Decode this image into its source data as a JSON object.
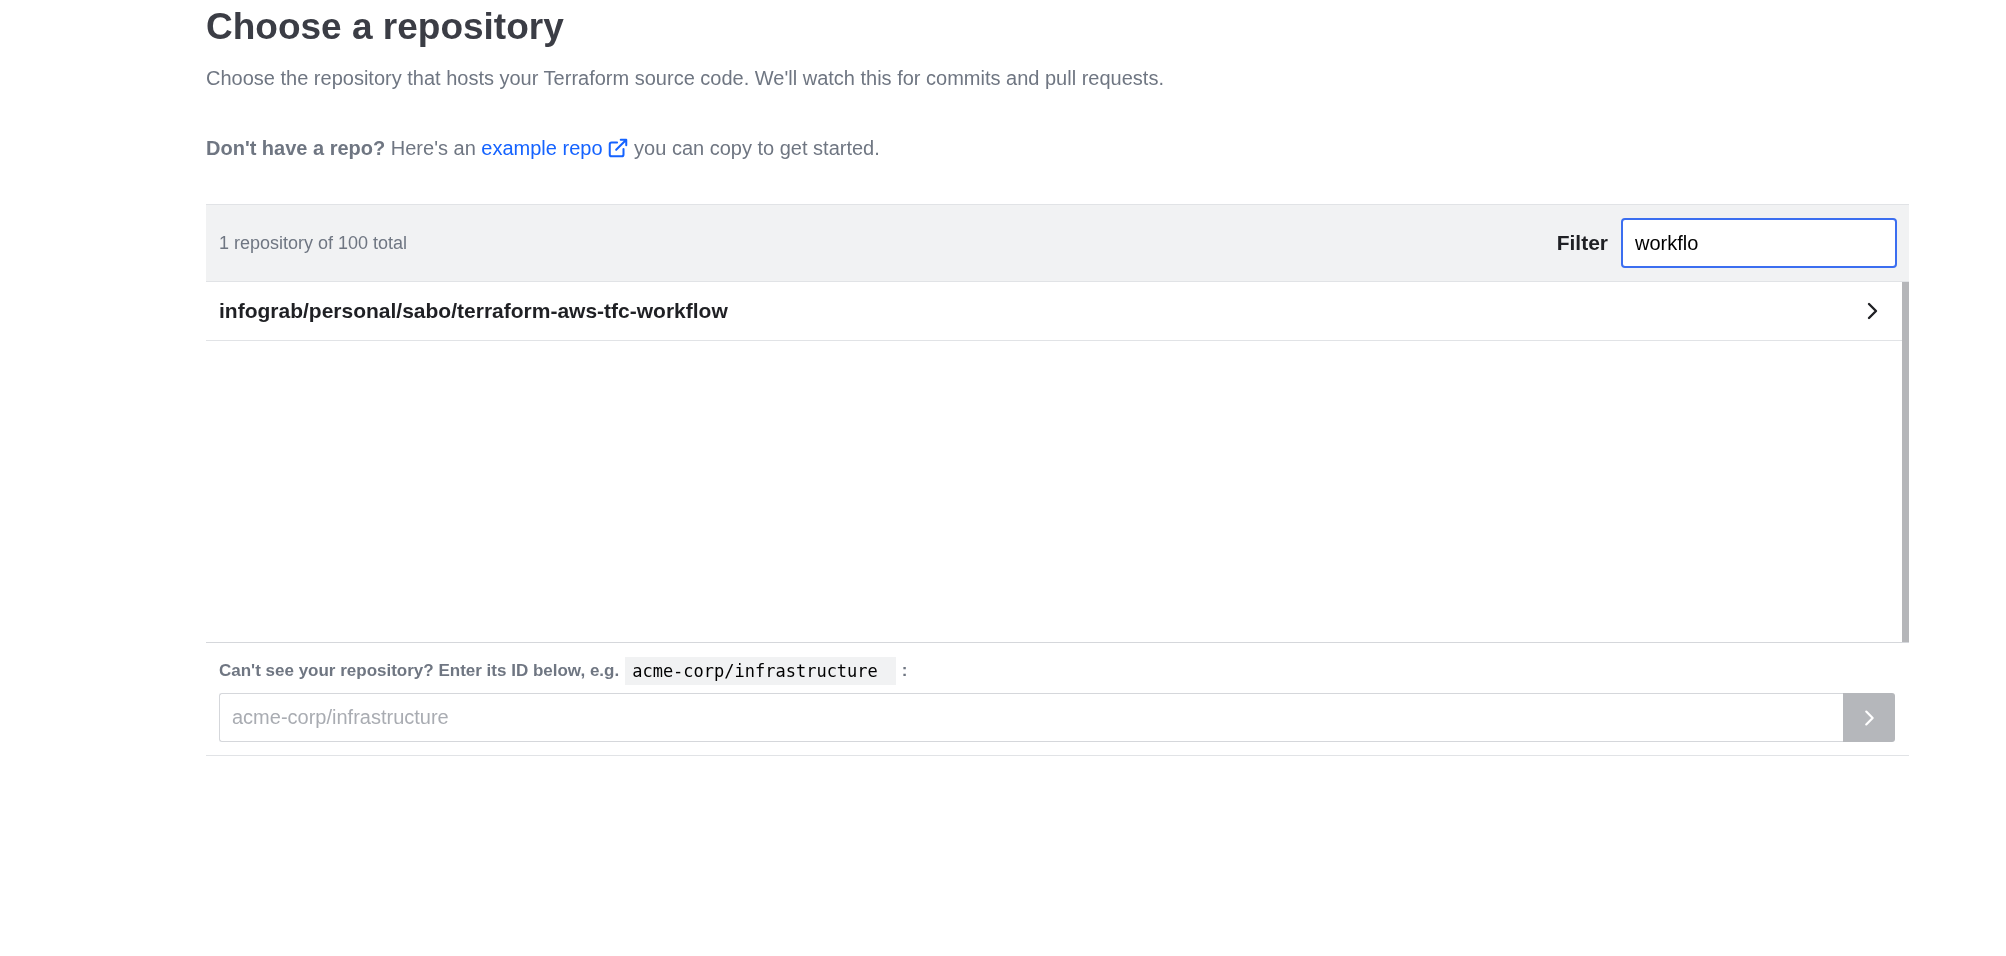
{
  "title": "Choose a repository",
  "description": "Choose the repository that hosts your Terraform source code. We'll watch this for commits and pull requests.",
  "intro": {
    "before": "**Don't have a repo?** Here's an",
    "link": "example repo",
    "after": "you can copy to get started."
  },
  "list_header": {
    "count": "1 repository of 100 total",
    "filter_label": "Filter",
    "filter_value": "workflo",
    "filter_focused": true
  },
  "repositories": [
    {
      "name": "infograb/personal/sabo/terraform-aws-tfc-workflow"
    }
  ],
  "manual_entry": {
    "hint": "Can't see your repository? Enter its ID below, e.g.",
    "example": "acme-corp/infrastructure",
    "hint_end": ":",
    "placeholder": "acme-corp/infrastructure",
    "submit_disabled": true
  }
}
